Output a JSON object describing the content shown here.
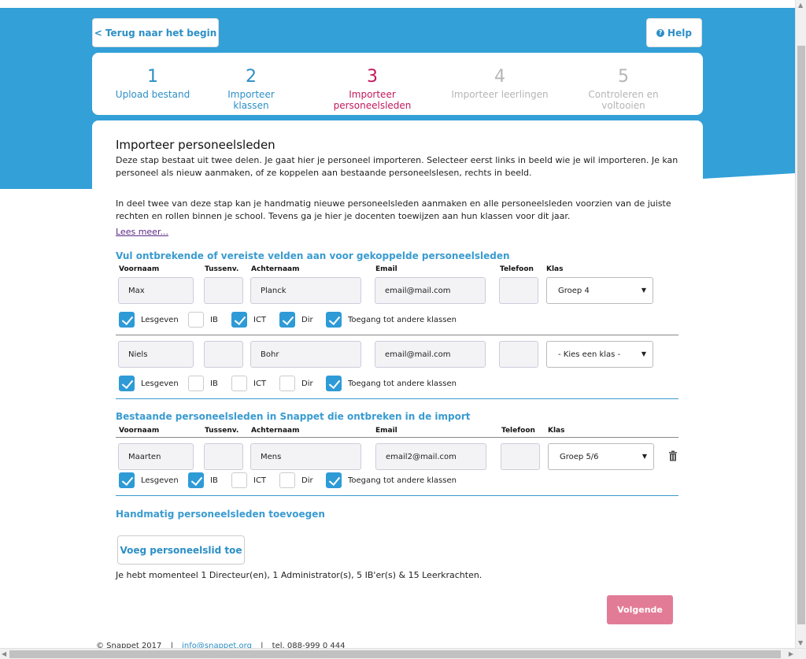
{
  "header": {
    "back_label": "< Terug naar het begin",
    "help_label": "Help"
  },
  "steps": [
    {
      "num": "1",
      "label": "Upload bestand",
      "state": "done"
    },
    {
      "num": "2",
      "label": "Importeer klassen",
      "state": "done"
    },
    {
      "num": "3",
      "label": "Importeer personeelsleden",
      "state": "active"
    },
    {
      "num": "4",
      "label": "Importeer leerlingen",
      "state": "todo"
    },
    {
      "num": "5",
      "label": "Controleren en voltooien",
      "state": "todo"
    }
  ],
  "main": {
    "title": "Importeer personeelsleden",
    "intro1": "Deze stap bestaat uit twee delen. Je gaat hier je personeel importeren. Selecteer eerst links in beeld wie je wil importeren. Je kan personeel als nieuw aanmaken, of ze koppelen aan bestaande personeelslesen, rechts in beeld.",
    "intro2": "In deel twee van deze stap kan je handmatig nieuwe personeelsleden aanmaken en alle personeelsleden voorzien van de juiste rechten en rollen binnen je school. Tevens ga je hier je docenten toewijzen aan hun klassen voor dit jaar.",
    "read_more": "Lees meer...",
    "section1_title": "Vul ontbrekende of vereiste velden aan voor gekoppelde personeelsleden",
    "section2_title": "Bestaande personeelsleden in Snappet die ontbreken in de import",
    "section3_title": "Handmatig personeelsleden toevoegen",
    "columns": {
      "first": "Voornaam",
      "infix": "Tussenv.",
      "last": "Achternaam",
      "email": "Email",
      "phone": "Telefoon",
      "class": "Klas"
    },
    "checkbox_labels": {
      "teach": "Lesgeven",
      "ib": "IB",
      "ict": "ICT",
      "dir": "Dir",
      "access": "Toegang tot andere klassen"
    },
    "linked_rows": [
      {
        "first": "Max",
        "infix": "",
        "last": "Planck",
        "email": "email@mail.com",
        "phone": "",
        "class": "Groep 4",
        "teach": true,
        "ib": false,
        "ict": true,
        "dir": true,
        "access": true
      },
      {
        "first": "Niels",
        "infix": "",
        "last": "Bohr",
        "email": "email@mail.com",
        "phone": "",
        "class": "- Kies een klas -",
        "teach": true,
        "ib": false,
        "ict": false,
        "dir": false,
        "access": true
      }
    ],
    "existing_rows": [
      {
        "first": "Maarten",
        "infix": "",
        "last": "Mens",
        "email": "email2@mail.com",
        "phone": "",
        "class": "Groep 5/6",
        "teach": true,
        "ib": true,
        "ict": false,
        "dir": false,
        "access": true
      }
    ],
    "add_button": "Voeg personeelslid toe",
    "summary": "Je hebt momenteel 1 Directeur(en), 1 Administrator(s), 5 IB'er(s) & 15 Leerkrachten.",
    "next_button": "Volgende"
  },
  "footer": {
    "copyright": "© Snappet 2017",
    "email": "info@snappet.org",
    "phone": "tel. 088-999 0 444"
  },
  "colors": {
    "brand_blue": "#33a0d8",
    "active_step": "#c2185b",
    "next_button": "#e27c96"
  }
}
